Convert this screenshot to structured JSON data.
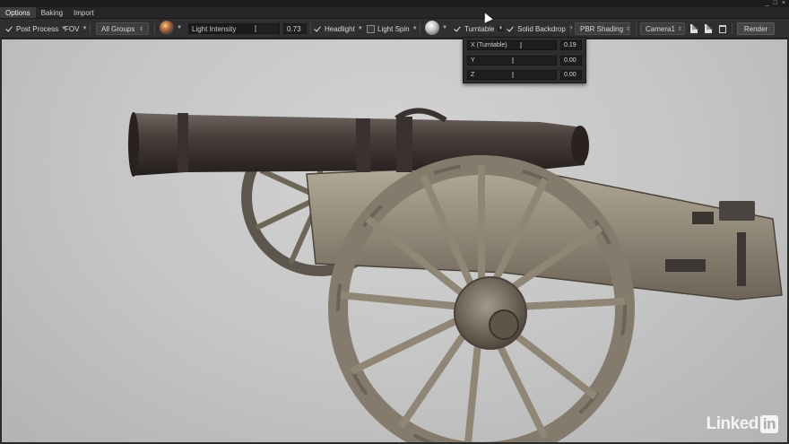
{
  "window": {
    "controls": [
      "_",
      "□",
      "×"
    ]
  },
  "tabs": [
    {
      "label": "Options",
      "active": true
    },
    {
      "label": "Baking",
      "active": false
    },
    {
      "label": "Import",
      "active": false
    }
  ],
  "toolbar": {
    "post_process": {
      "label": "Post Process",
      "checked": true
    },
    "fov_label": "FOV",
    "groups_value": "All Groups",
    "environment_icon": "environment-sphere-icon",
    "light_intensity": {
      "label": "Light Intensity",
      "value": "0.73",
      "level": 0.73
    },
    "headlight": {
      "label": "Headlight",
      "checked": true
    },
    "light_spin": {
      "label": "Light Spin",
      "checked": false
    },
    "light_icon": "light-sphere-icon",
    "light_enabled": true,
    "turntable": {
      "label": "Turntable",
      "checked": true
    },
    "solid_backdrop": {
      "label": "Solid Backdrop",
      "checked": true
    },
    "shading_value": "PBR Shading",
    "camera_value": "Camera1",
    "render_label": "Render"
  },
  "turntable_popup": {
    "rows": [
      {
        "label": "X (Turntable)",
        "value": "0.19",
        "level": 0.19
      },
      {
        "label": "Y",
        "value": "0.00",
        "level": 0.0
      },
      {
        "label": "Z",
        "value": "0.00",
        "level": 0.0
      }
    ]
  },
  "watermark": {
    "text": "Linked",
    "badge": "in"
  },
  "colors": {
    "viewport_bg": "#c8c8c8",
    "toolbar_bg": "#2f2f2f",
    "accent": "#e6e6e6"
  }
}
